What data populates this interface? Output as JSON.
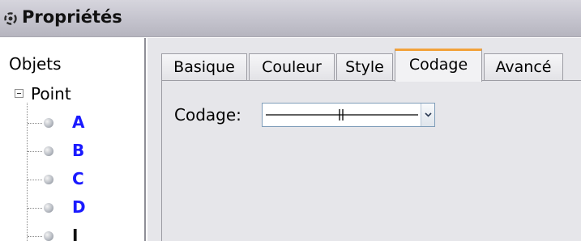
{
  "window": {
    "title": "Propriétés"
  },
  "tree": {
    "root_label": "Objets",
    "folder_label": "Point",
    "folder_expanded": true,
    "items": [
      {
        "label": "A",
        "color": "#1a1aff"
      },
      {
        "label": "B",
        "color": "#1a1aff"
      },
      {
        "label": "C",
        "color": "#1a1aff"
      },
      {
        "label": "D",
        "color": "#1a1aff"
      },
      {
        "label": "I",
        "color": "#111111"
      }
    ]
  },
  "tabs": [
    {
      "label": "Basique",
      "active": false
    },
    {
      "label": "Couleur",
      "active": false
    },
    {
      "label": "Style",
      "active": false
    },
    {
      "label": "Codage",
      "active": true
    },
    {
      "label": "Avancé",
      "active": false
    }
  ],
  "codage": {
    "label": "Codage:",
    "selected_icon": "double-tick-segment-icon"
  },
  "colors": {
    "active_tab_accent": "#f2a23b",
    "panel_background": "#e6e6ea"
  }
}
